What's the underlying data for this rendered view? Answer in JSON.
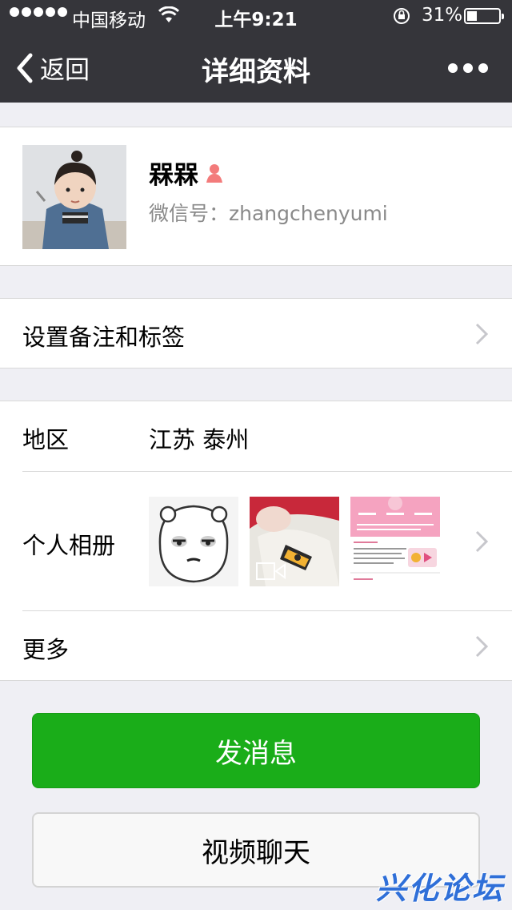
{
  "status_bar": {
    "carrier": "中国移动",
    "time": "上午9:21",
    "battery_percent": "31%",
    "battery_level": 0.31,
    "icons": [
      "signal-dots",
      "wifi-icon",
      "rotation-lock-icon",
      "battery-icon"
    ]
  },
  "nav": {
    "back_label": "返回",
    "title": "详细资料",
    "more_icon": "more-icon"
  },
  "profile": {
    "nickname": "槑槑",
    "gender_icon": "female-icon",
    "wechat_id": "微信号：zhangchenyumi"
  },
  "remark_row": {
    "label": "设置备注和标签"
  },
  "info": {
    "region_label": "地区",
    "region_value": "江苏 泰州",
    "album_label": "个人相册",
    "more_label": "更多"
  },
  "actions": {
    "send_message": "发消息",
    "video_chat": "视频聊天"
  },
  "watermark": "兴化论坛",
  "colors": {
    "nav_bg": "#35353a",
    "page_bg": "#efeff4",
    "primary_green": "#1aad19",
    "female_icon": "#f37b7b"
  }
}
